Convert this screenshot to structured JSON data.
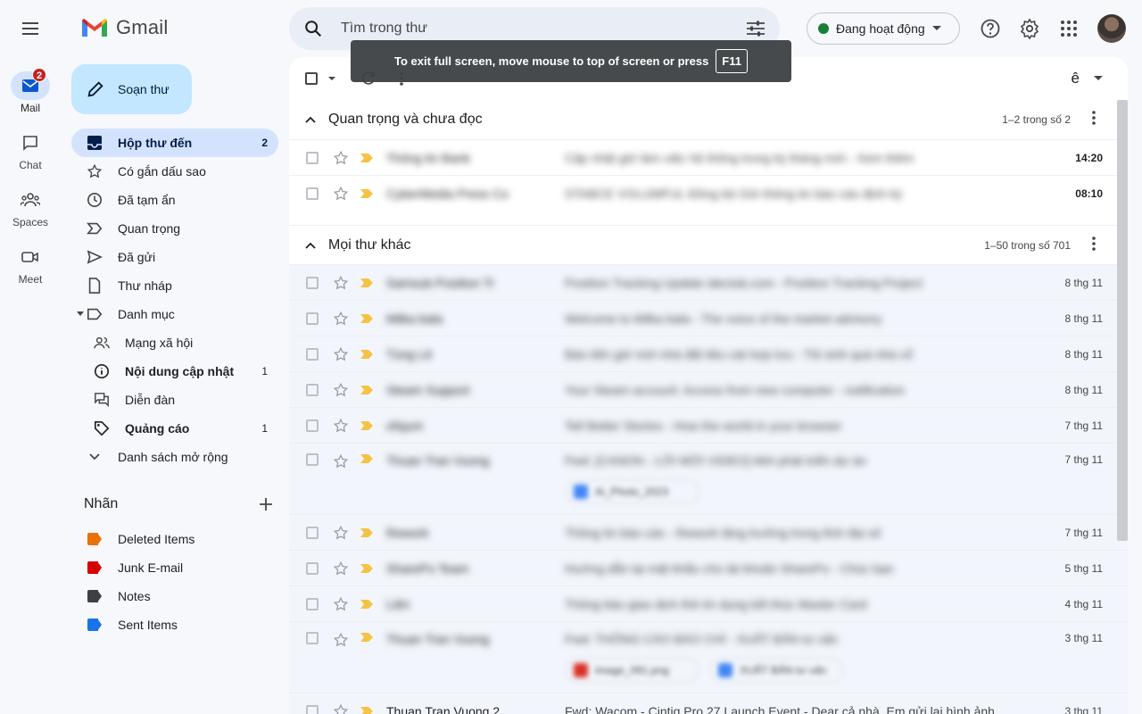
{
  "rail": {
    "items": [
      {
        "label": "Mail",
        "badge": "2"
      },
      {
        "label": "Chat"
      },
      {
        "label": "Spaces"
      },
      {
        "label": "Meet"
      }
    ]
  },
  "app": {
    "name": "Gmail"
  },
  "compose": {
    "label": "Soạn thư"
  },
  "nav": {
    "items": [
      {
        "label": "Hộp thư đến",
        "count": "2"
      },
      {
        "label": "Có gắn dấu sao"
      },
      {
        "label": "Đã tạm ẩn"
      },
      {
        "label": "Quan trọng"
      },
      {
        "label": "Đã gửi"
      },
      {
        "label": "Thư nháp"
      },
      {
        "label": "Danh mục"
      },
      {
        "label": "Mạng xã hội"
      },
      {
        "label": "Nội dung cập nhật",
        "count": "1"
      },
      {
        "label": "Diễn đàn"
      },
      {
        "label": "Quảng cáo",
        "count": "1"
      },
      {
        "label": "Danh sách mở rộng"
      }
    ]
  },
  "labels": {
    "title": "Nhãn",
    "items": [
      {
        "label": "Deleted Items",
        "color": "#e8710a"
      },
      {
        "label": "Junk E-mail",
        "color": "#d50000"
      },
      {
        "label": "Notes",
        "color": "#3c4043"
      },
      {
        "label": "Sent Items",
        "color": "#1a73e8"
      }
    ]
  },
  "search": {
    "placeholder": "Tìm trong thư"
  },
  "status": {
    "label": "Đang hoạt động",
    "color": "#188038"
  },
  "fullscreen": {
    "message": "To exit full screen, move mouse to top of screen or press",
    "key": "F11"
  },
  "sections": {
    "important": {
      "title": "Quan trọng và chưa đọc",
      "range": "1–2 trong số 2"
    },
    "everything": {
      "title": "Mọi thư khác",
      "range": "1–50 trong số 701"
    }
  },
  "important_rows": [
    {
      "sender": "Thông tin Bank",
      "subject": "Cập nhật giờ làm việc hệ thống trong kỳ tháng mới - Xem thêm",
      "date": "14:20"
    },
    {
      "sender": "CyberMedia Press Co",
      "subject": "STABCE VOLUMFUL Đồng bộ Gửi thông tin báo cáo định kỳ",
      "date": "08:10"
    }
  ],
  "other_rows": [
    {
      "sender": "Samsub Position Tr",
      "subject": "Position Tracking Update ideclub.com - Position Tracking Project",
      "date": "8 thg 11"
    },
    {
      "sender": "Milka bala",
      "subject": "Welcome to Milka bala - The voice of the market advisory",
      "date": "8 thg 11"
    },
    {
      "sender": "Tùng Lê",
      "subject": "Báo tiến giờ mới nhà đất tiêu cát hợp lưu - Tôi sinh quá nhà cổ",
      "date": "8 thg 11"
    },
    {
      "sender": "Steam Support",
      "subject": "Your Steam account: Access from new computer - notification",
      "date": "8 thg 11"
    },
    {
      "sender": "ofsjum",
      "subject": "Tell Better Stories - How the world in your browser",
      "date": "7 thg 11"
    },
    {
      "sender": "Thuan Tran Vuong",
      "subject": "Fwd: [CANON - LỜI MỜI VIDEO] Mời phát triển dự án",
      "date": "7 thg 11",
      "attachments": [
        "Ai_Photo_2023"
      ]
    },
    {
      "sender": "Rework",
      "subject": "Thông tin báo cáo - Rework tăng trưởng trong thời đại số",
      "date": "7 thg 11"
    },
    {
      "sender": "SharePo Team",
      "subject": "Hướng dẫn lại mật khẩu cho tài khoản SharePo - Chúc bạn",
      "date": "5 thg 11"
    },
    {
      "sender": "Liên",
      "subject": "Thông báo giao dịch thẻ tín dụng kết thúc Master Card",
      "date": "4 thg 11"
    },
    {
      "sender": "Thuan Tran Vuong",
      "subject": "Fwd: THÔNG CÁO BÁO CHÍ - XUẤT BẢN tư vấn",
      "date": "3 thg 11",
      "attachments": [
        "image_091.png",
        "XUẤT BẢN tư vấn"
      ]
    },
    {
      "sender": "Thuan Tran Vuong 2",
      "subject": "Fwd: Wacom - Cintiq Pro 27 Launch Event - Dear cả nhà, Em gửi lại hình ảnh",
      "date": "3 thg 11"
    }
  ]
}
